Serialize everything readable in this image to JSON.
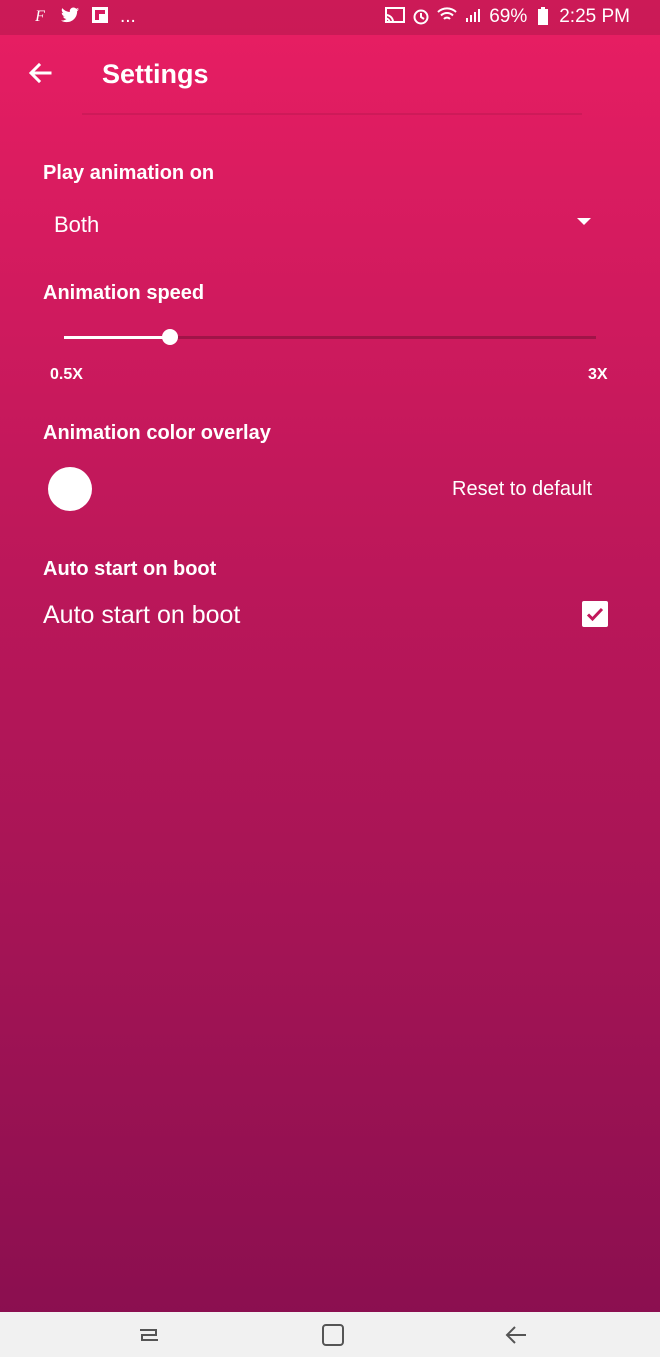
{
  "status_bar": {
    "left_icons": [
      "facebook-icon",
      "twitter-icon",
      "flipboard-icon"
    ],
    "more": "...",
    "battery_percent": "69%",
    "time": "2:25 PM"
  },
  "header": {
    "title": "Settings"
  },
  "settings": {
    "play_animation": {
      "label": "Play animation on",
      "value": "Both"
    },
    "animation_speed": {
      "label": "Animation speed",
      "min_label": "0.5X",
      "max_label": "3X",
      "min": 0.5,
      "max": 3,
      "value": 1.0
    },
    "color_overlay": {
      "label": "Animation color overlay",
      "color": "#ffffff",
      "reset_label": "Reset to default"
    },
    "auto_start": {
      "section_label": "Auto start on boot",
      "checkbox_label": "Auto start on boot",
      "checked": true
    }
  },
  "colors": {
    "gradient_top": "#e91e63",
    "gradient_bottom": "#880e4f",
    "nav_bar": "#f1f1f1"
  }
}
